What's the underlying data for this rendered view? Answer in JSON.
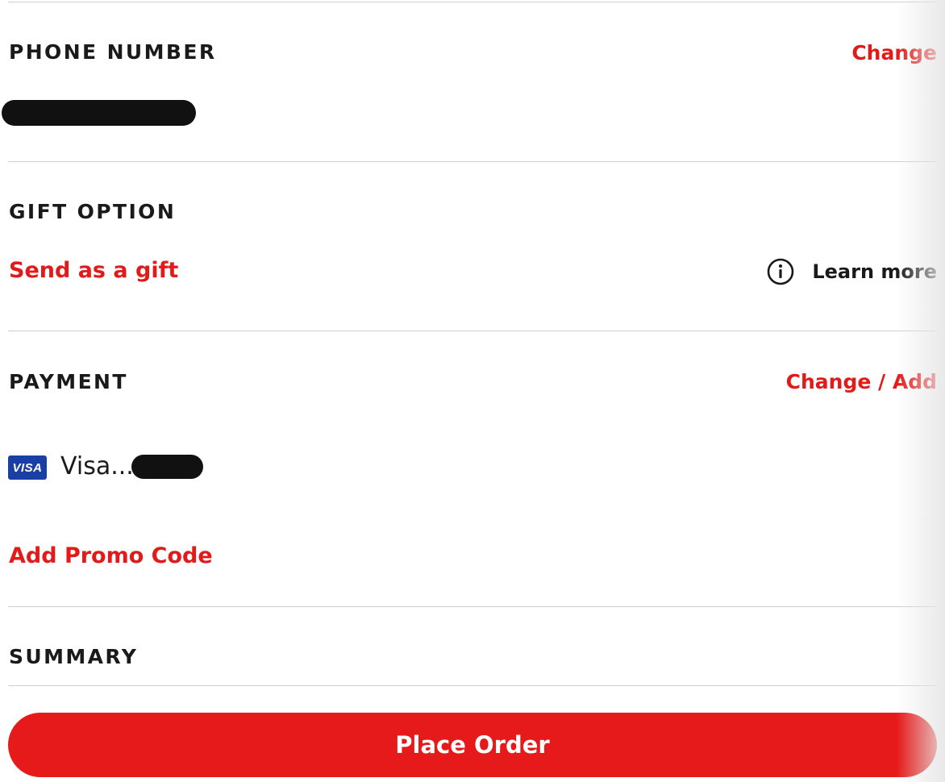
{
  "phone": {
    "title": "PHONE NUMBER",
    "change_label": "Change"
  },
  "gift": {
    "title": "GIFT OPTION",
    "send_label": "Send as a gift",
    "learn_more_label": "Learn more",
    "info_icon": "info-circle-icon"
  },
  "payment": {
    "title": "PAYMENT",
    "change_add_label": "Change / Add",
    "card_brand_badge": "VISA",
    "card_label": "Visa....",
    "promo_label": "Add Promo Code"
  },
  "summary": {
    "title": "SUMMARY"
  },
  "footer": {
    "place_order_label": "Place Order"
  },
  "colors": {
    "accent": "#e21a1a",
    "button": "#e61a1a",
    "text": "#1a1a1a",
    "divider": "#cfcfcf",
    "visa_blue": "#1a3fa3"
  }
}
